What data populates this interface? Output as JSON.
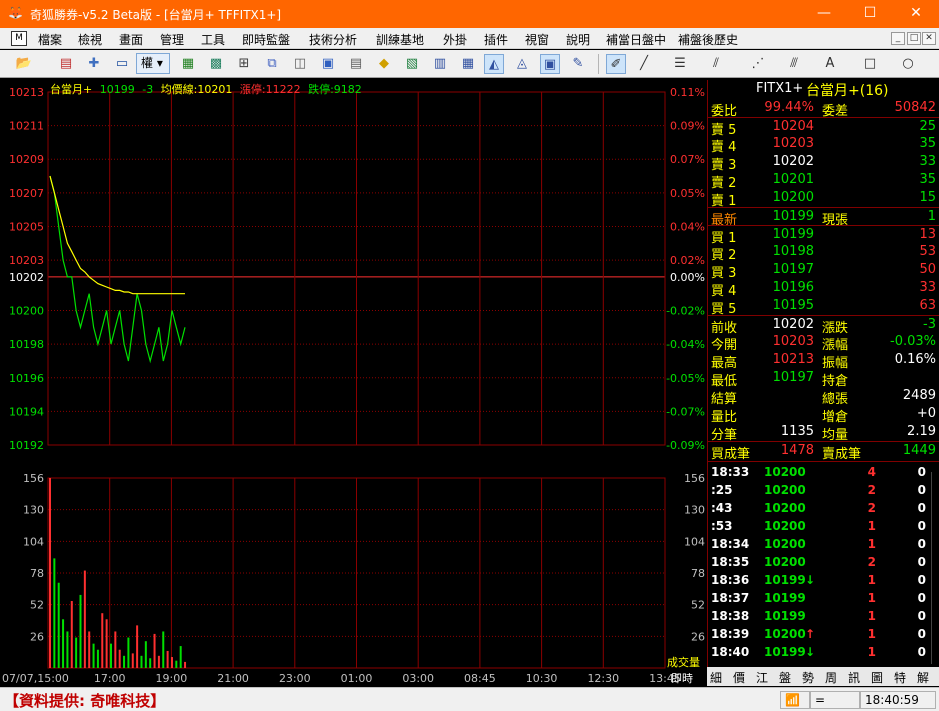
{
  "window": {
    "title": "奇狐勝券-v5.2 Beta版 - [台當月+ TFFITX1+]",
    "minimize": "—",
    "maximize": "☐",
    "close": "✕"
  },
  "menu": {
    "items": [
      "檔案",
      "檢視",
      "畫面",
      "管理",
      "工具",
      "即時監盤",
      "技術分析",
      "訓練基地",
      "外掛",
      "插件",
      "視窗",
      "說明",
      "補當日盤中",
      "補盤後歷史"
    ],
    "mdi_buttons": [
      "_",
      "□",
      "✕"
    ]
  },
  "toolbar": {
    "combo_label": "權"
  },
  "chart": {
    "header": {
      "symbol": "台當月+",
      "price": "10199",
      "change": "-3",
      "avg_label": "均價線:10201",
      "limit_up": "漲停:11222",
      "limit_down": "跌停:9182"
    },
    "price_ticks": [
      "10213",
      "10211",
      "10209",
      "10207",
      "10205",
      "10203",
      "10202",
      "10200",
      "10198",
      "10196",
      "10194",
      "10192"
    ],
    "pct_ticks": [
      "0.11%",
      "0.09%",
      "0.07%",
      "0.05%",
      "0.04%",
      "0.02%",
      "0.00%",
      "-0.02%",
      "-0.04%",
      "-0.05%",
      "-0.07%",
      "-0.09%"
    ],
    "volume_ticks": [
      "156",
      "130",
      "104",
      "78",
      "52",
      "26"
    ],
    "volume_label": "成交量",
    "time_ticks": [
      "07/07,15:00",
      "17:00",
      "19:00",
      "21:00",
      "23:00",
      "01:00",
      "03:00",
      "08:45",
      "10:30",
      "12:30",
      "13:45"
    ],
    "realtime_label": "即時",
    "colors": {
      "up": "#ff3030",
      "down": "#00e000",
      "avg": "#ffff00",
      "grid": "#8b0000",
      "ref": "#ff3030"
    }
  },
  "chart_data": {
    "type": "line",
    "title": "台當月+",
    "ylim": [
      10192,
      10213
    ],
    "reference": 10202,
    "price_series_note": "minute trade price, 15:00 to ~19:30",
    "price": [
      10208,
      10207,
      10205,
      10203,
      10202,
      10202,
      10200,
      10199,
      10200,
      10201,
      10199,
      10198,
      10199,
      10200,
      10198,
      10199,
      10200,
      10198,
      10197,
      10199,
      10201,
      10200,
      10198,
      10197,
      10198,
      10199,
      10197,
      10198,
      10200,
      10199,
      10198,
      10199
    ],
    "avg": [
      10208,
      10207,
      10206,
      10205,
      10204,
      10203.5,
      10203,
      10202.5,
      10202.3,
      10202,
      10201.8,
      10201.6,
      10201.5,
      10201.4,
      10201.3,
      10201.2,
      10201.2,
      10201.1,
      10201.1,
      10201,
      10201,
      10201,
      10201,
      10201,
      10201,
      10201,
      10201,
      10201,
      10201,
      10201,
      10201,
      10201
    ],
    "volume_ylim": [
      0,
      156
    ],
    "volume": [
      156,
      90,
      70,
      40,
      30,
      55,
      25,
      60,
      80,
      30,
      20,
      15,
      45,
      40,
      20,
      30,
      15,
      10,
      25,
      12,
      35,
      10,
      22,
      8,
      28,
      10,
      30,
      14,
      9,
      6,
      18,
      5
    ]
  },
  "panel": {
    "title": "FITX1+",
    "title2": "台當月+(16)",
    "ratio": {
      "label": "委比",
      "value": "99.44%",
      "label2": "委差",
      "value2": "50842"
    },
    "asks": [
      {
        "label": "賣 5",
        "price": "10204",
        "qty": "25"
      },
      {
        "label": "賣 4",
        "price": "10203",
        "qty": "35"
      },
      {
        "label": "賣 3",
        "price": "10202",
        "qty": "33"
      },
      {
        "label": "賣 2",
        "price": "10201",
        "qty": "35"
      },
      {
        "label": "賣 1",
        "price": "10200",
        "qty": "15"
      }
    ],
    "last": {
      "label": "最新",
      "price": "10199",
      "label2": "現張",
      "qty": "1"
    },
    "bids": [
      {
        "label": "買 1",
        "price": "10199",
        "qty": "13"
      },
      {
        "label": "買 2",
        "price": "10198",
        "qty": "53"
      },
      {
        "label": "買 3",
        "price": "10197",
        "qty": "50"
      },
      {
        "label": "買 4",
        "price": "10196",
        "qty": "33"
      },
      {
        "label": "買 5",
        "price": "10195",
        "qty": "63"
      }
    ],
    "stats": [
      {
        "l1": "前收",
        "v1": "10202",
        "l2": "漲跌",
        "v2": "-3"
      },
      {
        "l1": "今開",
        "v1": "10203",
        "l2": "漲幅",
        "v2": "-0.03%"
      },
      {
        "l1": "最高",
        "v1": "10213",
        "l2": "振幅",
        "v2": "0.16%"
      },
      {
        "l1": "最低",
        "v1": "10197",
        "l2": "持倉",
        "v2": ""
      },
      {
        "l1": "結算",
        "v1": "",
        "l2": "總張",
        "v2": "2489"
      },
      {
        "l1": "量比",
        "v1": "",
        "l2": "增倉",
        "v2": "+0"
      },
      {
        "l1": "分筆",
        "v1": "1135",
        "l2": "均量",
        "v2": "2.19"
      }
    ],
    "trades_count": {
      "l1": "買成筆",
      "v1": "1478",
      "l2": "賣成筆",
      "v2": "1449"
    },
    "ticks": [
      {
        "time": "18:33",
        "price": "10200",
        "mark": "",
        "vol": "4",
        "x": "0"
      },
      {
        "time": ":25",
        "price": "10200",
        "mark": "",
        "vol": "2",
        "x": "0"
      },
      {
        "time": ":43",
        "price": "10200",
        "mark": "",
        "vol": "2",
        "x": "0"
      },
      {
        "time": ":53",
        "price": "10200",
        "mark": "",
        "vol": "1",
        "x": "0"
      },
      {
        "time": "18:34",
        "price": "10200",
        "mark": "",
        "vol": "1",
        "x": "0"
      },
      {
        "time": "18:35",
        "price": "10200",
        "mark": "",
        "vol": "2",
        "x": "0"
      },
      {
        "time": "18:36",
        "price": "10199",
        "mark": "↓",
        "vol": "1",
        "x": "0"
      },
      {
        "time": "18:37",
        "price": "10199",
        "mark": "",
        "vol": "1",
        "x": "0"
      },
      {
        "time": "18:38",
        "price": "10199",
        "mark": "",
        "vol": "1",
        "x": "0"
      },
      {
        "time": "18:39",
        "price": "10200",
        "mark": "↑",
        "vol": "1",
        "x": "0"
      },
      {
        "time": "18:40",
        "price": "10199",
        "mark": "↓",
        "vol": "1",
        "x": "0"
      }
    ],
    "tabs": [
      "細",
      "價",
      "江",
      "盤",
      "勢",
      "周",
      "訊",
      "圖",
      "特",
      "解"
    ]
  },
  "status": {
    "source": "【資料提供: 奇唯科技】",
    "equals": "=",
    "clock": "18:40:59"
  }
}
